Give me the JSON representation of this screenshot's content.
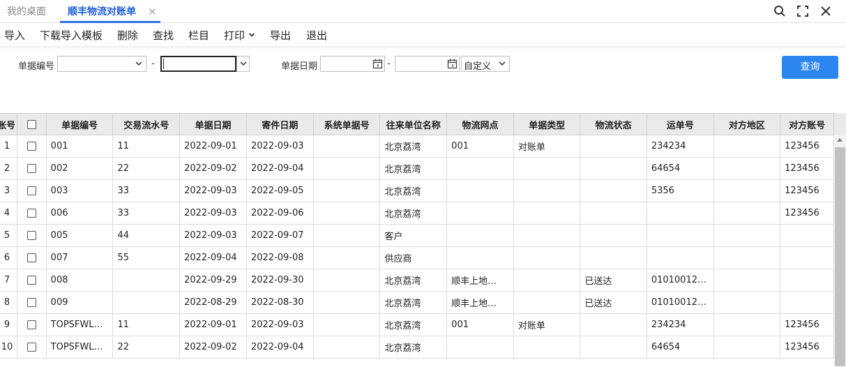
{
  "tabs": {
    "home": "我的桌面",
    "active": "顺丰物流对账单",
    "close": "✕"
  },
  "toolbar": {
    "import": "导入",
    "download_template": "下载导入模板",
    "delete": "删除",
    "find": "查找",
    "columns": "栏目",
    "print": "打印",
    "export": "导出",
    "exit": "退出"
  },
  "filters": {
    "doc_no_label": "单据编号",
    "doc_no_from": "",
    "doc_no_to": "",
    "separator": "-",
    "doc_date_label": "单据日期",
    "date_from": "",
    "date_to": "",
    "date_range": "自定义",
    "query": "查询"
  },
  "table": {
    "columns": [
      "账号",
      "",
      "单据编号",
      "交易流水号",
      "单据日期",
      "寄件日期",
      "系统单据号",
      "往来单位名称",
      "物流网点",
      "单据类型",
      "物流状态",
      "运单号",
      "对方地区",
      "对方账号"
    ],
    "rows": [
      [
        "1",
        "001",
        "11",
        "2022-09-01",
        "2022-09-03",
        "",
        "北京荔湾",
        "001",
        "对账单",
        "",
        "234234",
        "",
        "123456"
      ],
      [
        "2",
        "002",
        "22",
        "2022-09-02",
        "2022-09-04",
        "",
        "北京荔湾",
        "",
        "",
        "",
        "64654",
        "",
        "123456"
      ],
      [
        "3",
        "003",
        "33",
        "2022-09-03",
        "2022-09-05",
        "",
        "北京荔湾",
        "",
        "",
        "",
        "5356",
        "",
        "123456"
      ],
      [
        "4",
        "006",
        "33",
        "2022-09-03",
        "2022-09-06",
        "",
        "北京荔湾",
        "",
        "",
        "",
        "",
        "",
        "123456"
      ],
      [
        "5",
        "005",
        "44",
        "2022-09-03",
        "2022-09-07",
        "",
        "客户",
        "",
        "",
        "",
        "",
        "",
        ""
      ],
      [
        "6",
        "007",
        "55",
        "2022-09-04",
        "2022-09-08",
        "",
        "供应商",
        "",
        "",
        "",
        "",
        "",
        ""
      ],
      [
        "7",
        "008",
        "",
        "2022-09-29",
        "2022-09-30",
        "",
        "北京荔湾",
        "顺丰上地…",
        "",
        "已送达",
        "01010012…",
        "",
        ""
      ],
      [
        "8",
        "009",
        "",
        "2022-08-29",
        "2022-08-30",
        "",
        "北京荔湾",
        "顺丰上地…",
        "",
        "已送达",
        "01010012…",
        "",
        ""
      ],
      [
        "9",
        "TOPSFWL…",
        "11",
        "2022-09-01",
        "2022-09-03",
        "",
        "北京荔湾",
        "001",
        "对账单",
        "",
        "234234",
        "",
        "123456"
      ],
      [
        "10",
        "TOPSFWL…",
        "22",
        "2022-09-02",
        "2022-09-04",
        "",
        "北京荔湾",
        "",
        "",
        "",
        "64654",
        "",
        "123456"
      ]
    ]
  },
  "icons": [
    "search-icon",
    "maximize-icon",
    "close-icon",
    "chevron-down-icon",
    "calendar-icon"
  ]
}
